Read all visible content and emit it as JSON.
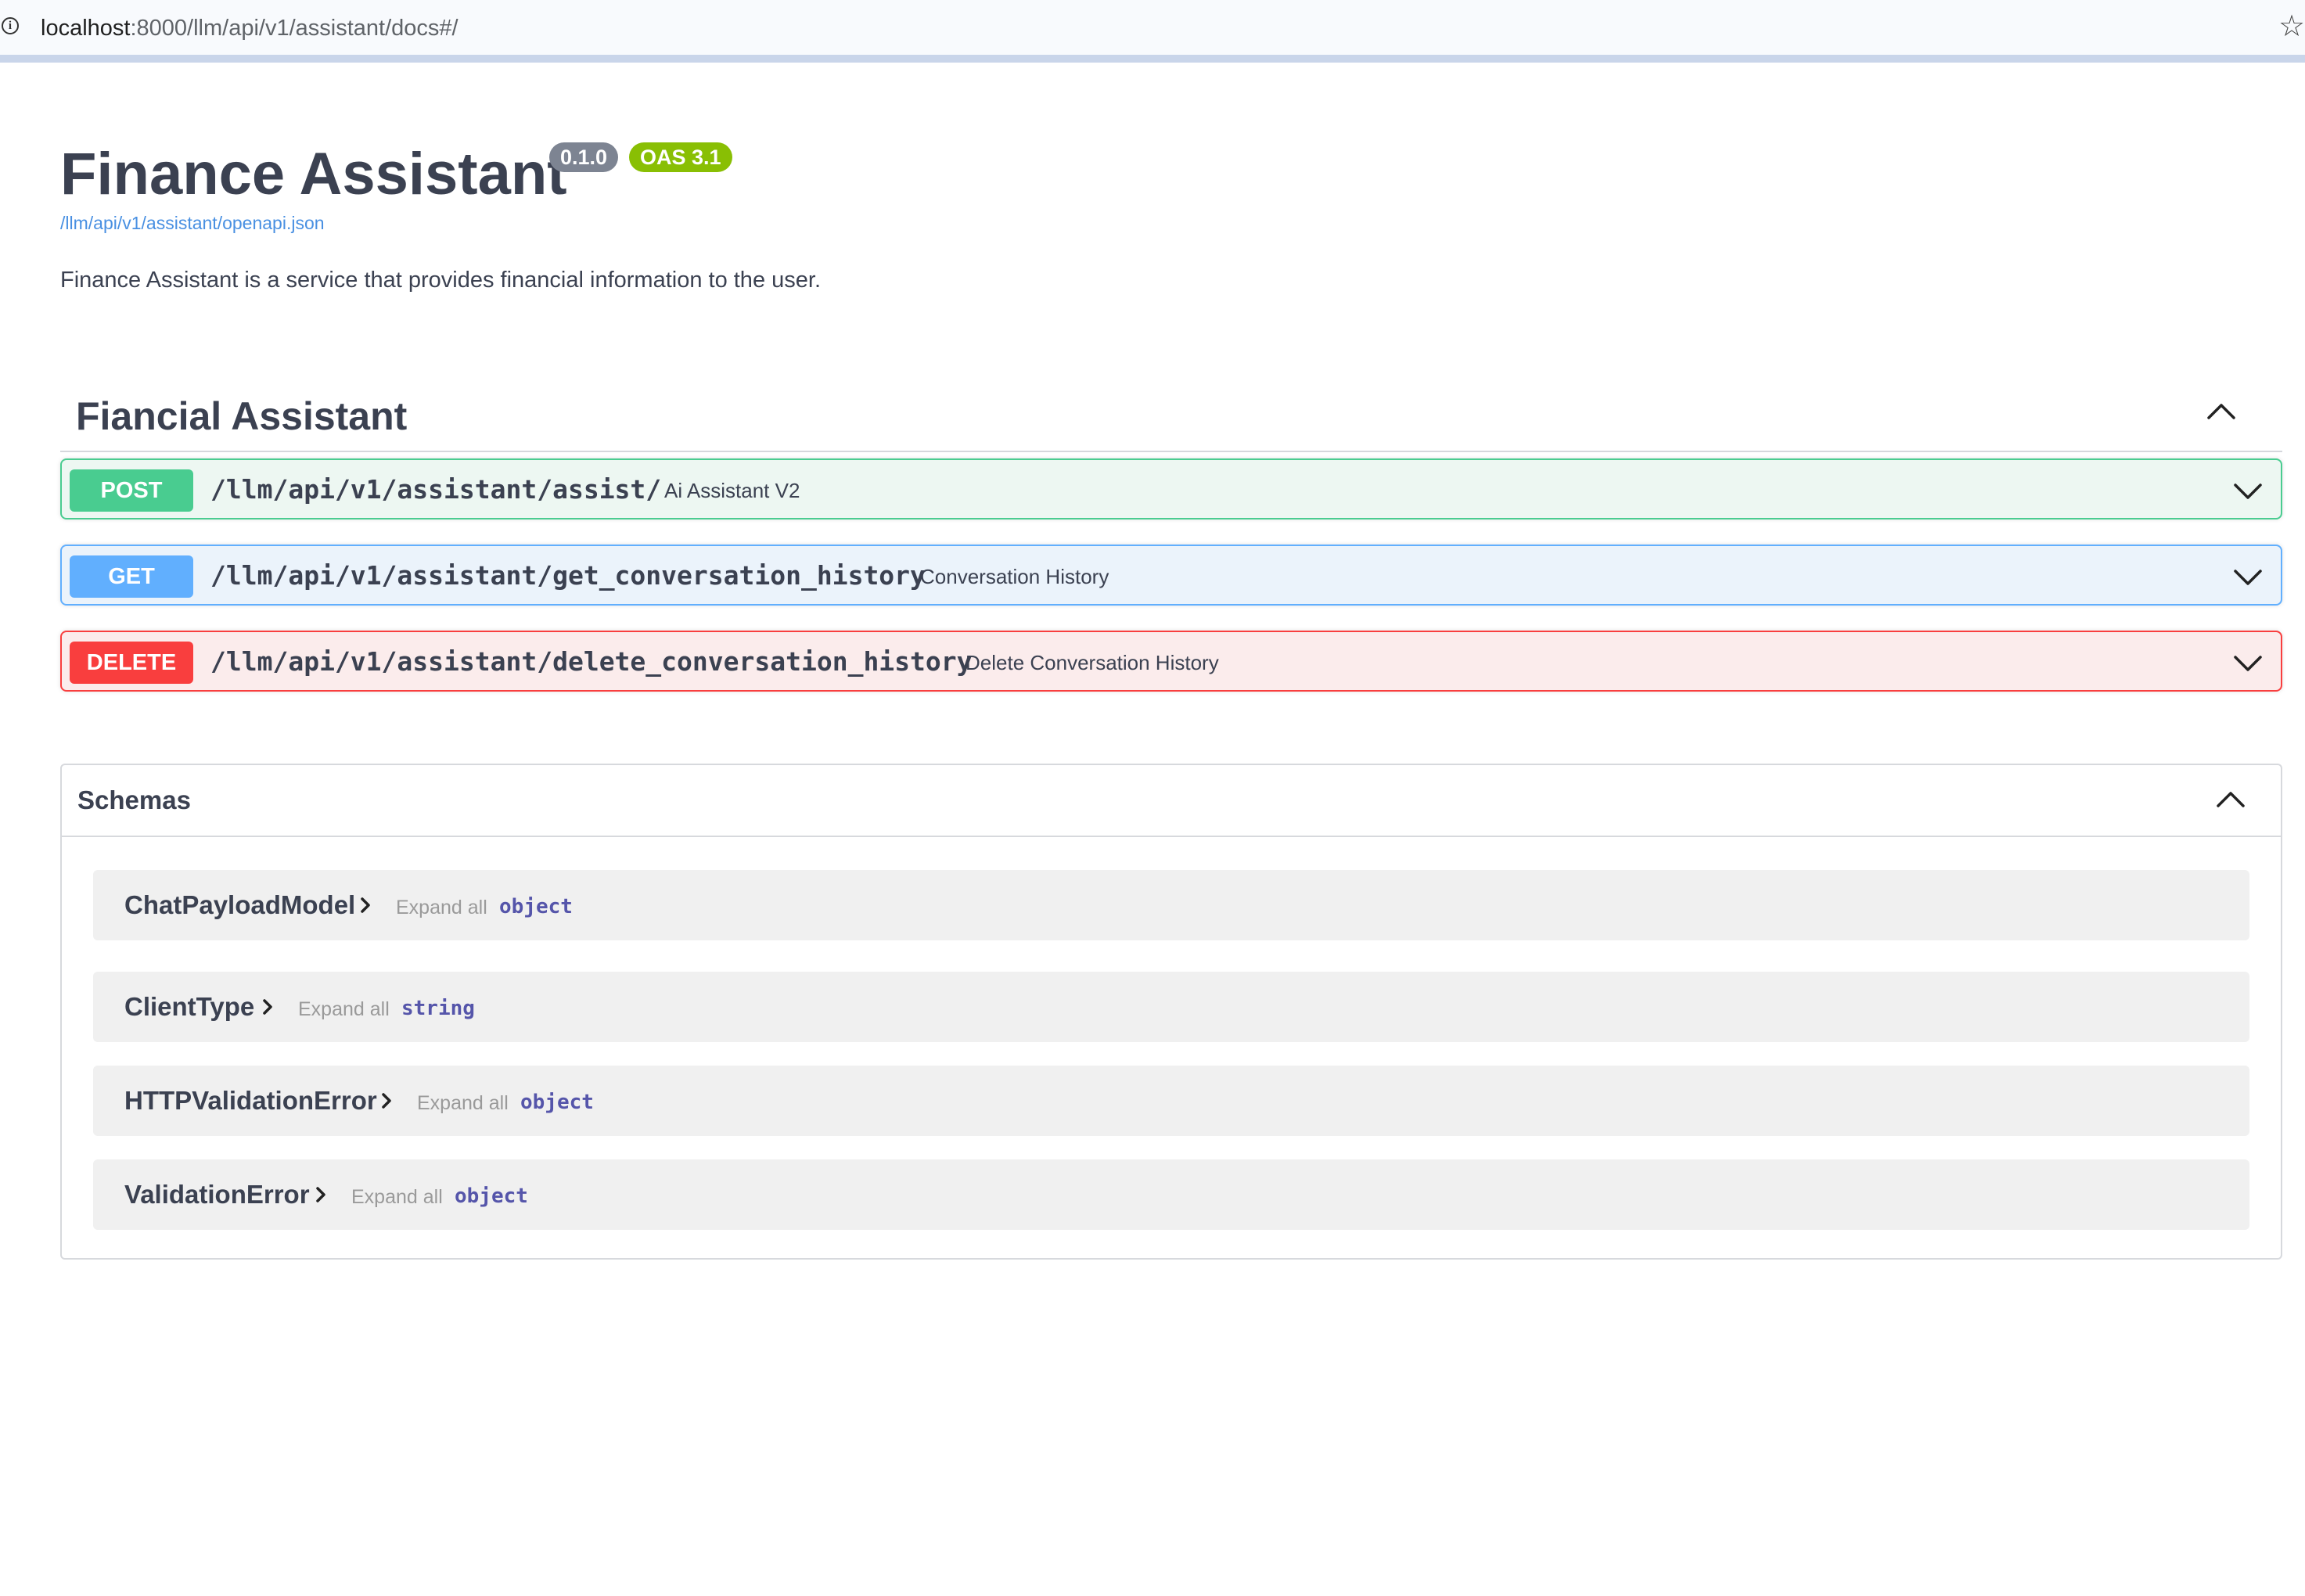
{
  "browser": {
    "url_host": "localhost",
    "url_path": ":8000/llm/api/v1/assistant/docs#/"
  },
  "info": {
    "title": "Finance Assistant",
    "version": "0.1.0",
    "oas": "OAS 3.1",
    "spec_url": "/llm/api/v1/assistant/openapi.json",
    "description": "Finance Assistant is a service that provides financial information to the user."
  },
  "tag": {
    "name": "Fiancial Assistant",
    "operations": [
      {
        "method": "POST",
        "path": "/llm/api/v1/assistant/assist/",
        "summary": "Ai Assistant V2",
        "color": "#49cc90"
      },
      {
        "method": "GET",
        "path": "/llm/api/v1/assistant/get_conversation_history",
        "summary": "Conversation History",
        "color": "#61affe"
      },
      {
        "method": "DELETE",
        "path": "/llm/api/v1/assistant/delete_conversation_history",
        "summary": "Delete Conversation History",
        "color": "#f93e3e"
      }
    ]
  },
  "schemas": {
    "title": "Schemas",
    "expand_label": "Expand all",
    "models": [
      {
        "name": "ChatPayloadModel",
        "type": "object"
      },
      {
        "name": "ClientType",
        "type": "string"
      },
      {
        "name": "HTTPValidationError",
        "type": "object"
      },
      {
        "name": "ValidationError",
        "type": "object"
      }
    ]
  },
  "icons": {
    "page_info": "info-icon",
    "bookmark": "star-icon",
    "collapse": "chevron-up-icon",
    "expand": "chevron-down-icon",
    "model_expand": "chevron-right-icon"
  }
}
